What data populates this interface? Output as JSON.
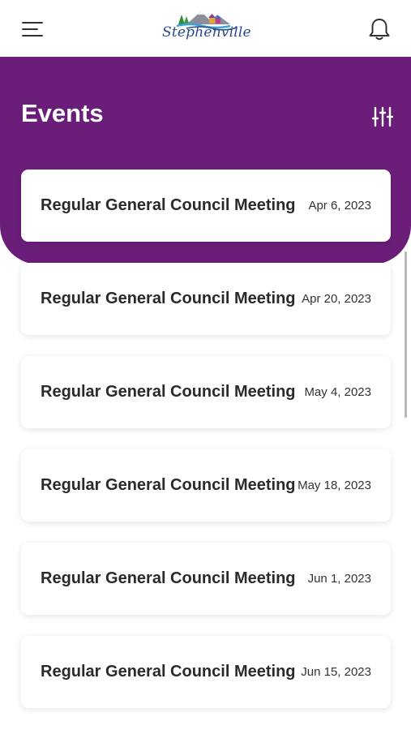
{
  "app": {
    "brand_name": "Stephenville",
    "icons": {
      "menu": "hamburger-menu-icon",
      "notifications": "bell-icon",
      "filter": "sliders-filter-icon"
    },
    "colors": {
      "header_purple": "#6a1e7a",
      "logo_blue": "#2a4a8c",
      "card_background": "#ffffff",
      "title_text": "#2a2a2a"
    }
  },
  "page": {
    "title": "Events"
  },
  "events": [
    {
      "title": "Regular General Council Meeting",
      "date": "Apr 6, 2023"
    },
    {
      "title": "Regular General Council Meeting",
      "date": "Apr 20, 2023"
    },
    {
      "title": "Regular General Council Meeting",
      "date": "May 4, 2023"
    },
    {
      "title": "Regular General Council Meeting",
      "date": "May 18, 2023"
    },
    {
      "title": "Regular General Council Meeting",
      "date": "Jun 1, 2023"
    },
    {
      "title": "Regular General Council Meeting",
      "date": "Jun 15, 2023"
    }
  ]
}
